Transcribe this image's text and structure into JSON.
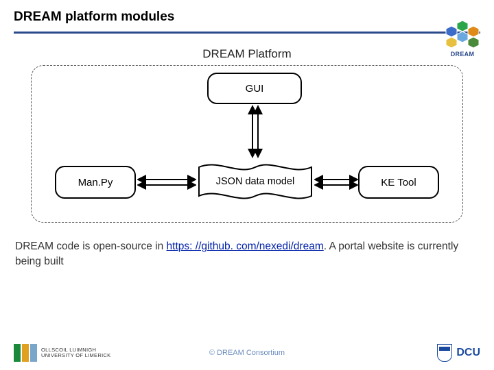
{
  "title": "DREAM platform modules",
  "brand_label": "DREAM",
  "platform_title": "DREAM Platform",
  "nodes": {
    "gui": "GUI",
    "manpy": "Man.Py",
    "json_model": "JSON data model",
    "ketool": "KE Tool"
  },
  "caption_pre": "DREAM code is open-source in ",
  "caption_link_text": "https: //github. com/nexedi/dream",
  "caption_link_href": "https://github.com/nexedi/dream",
  "caption_post": ". A portal website is currently being built",
  "footer_center": "© DREAM Consortium",
  "footer_left_line1": "OLLSCOIL LUIMNIGH",
  "footer_left_line2": "UNIVERSITY OF LIMERICK",
  "footer_right": "DCU",
  "chart_data": {
    "type": "diagram",
    "title": "DREAM Platform",
    "container": "DREAM Platform (dashed boundary)",
    "nodes": [
      {
        "id": "gui",
        "label": "GUI",
        "shape": "rounded-rect"
      },
      {
        "id": "manpy",
        "label": "Man.Py",
        "shape": "rounded-rect"
      },
      {
        "id": "json_model",
        "label": "JSON data model",
        "shape": "document"
      },
      {
        "id": "ketool",
        "label": "KE Tool",
        "shape": "rounded-rect"
      }
    ],
    "edges": [
      {
        "from": "gui",
        "to": "json_model",
        "bidirectional": true
      },
      {
        "from": "manpy",
        "to": "json_model",
        "bidirectional": true
      },
      {
        "from": "json_model",
        "to": "ketool",
        "bidirectional": true
      }
    ]
  }
}
